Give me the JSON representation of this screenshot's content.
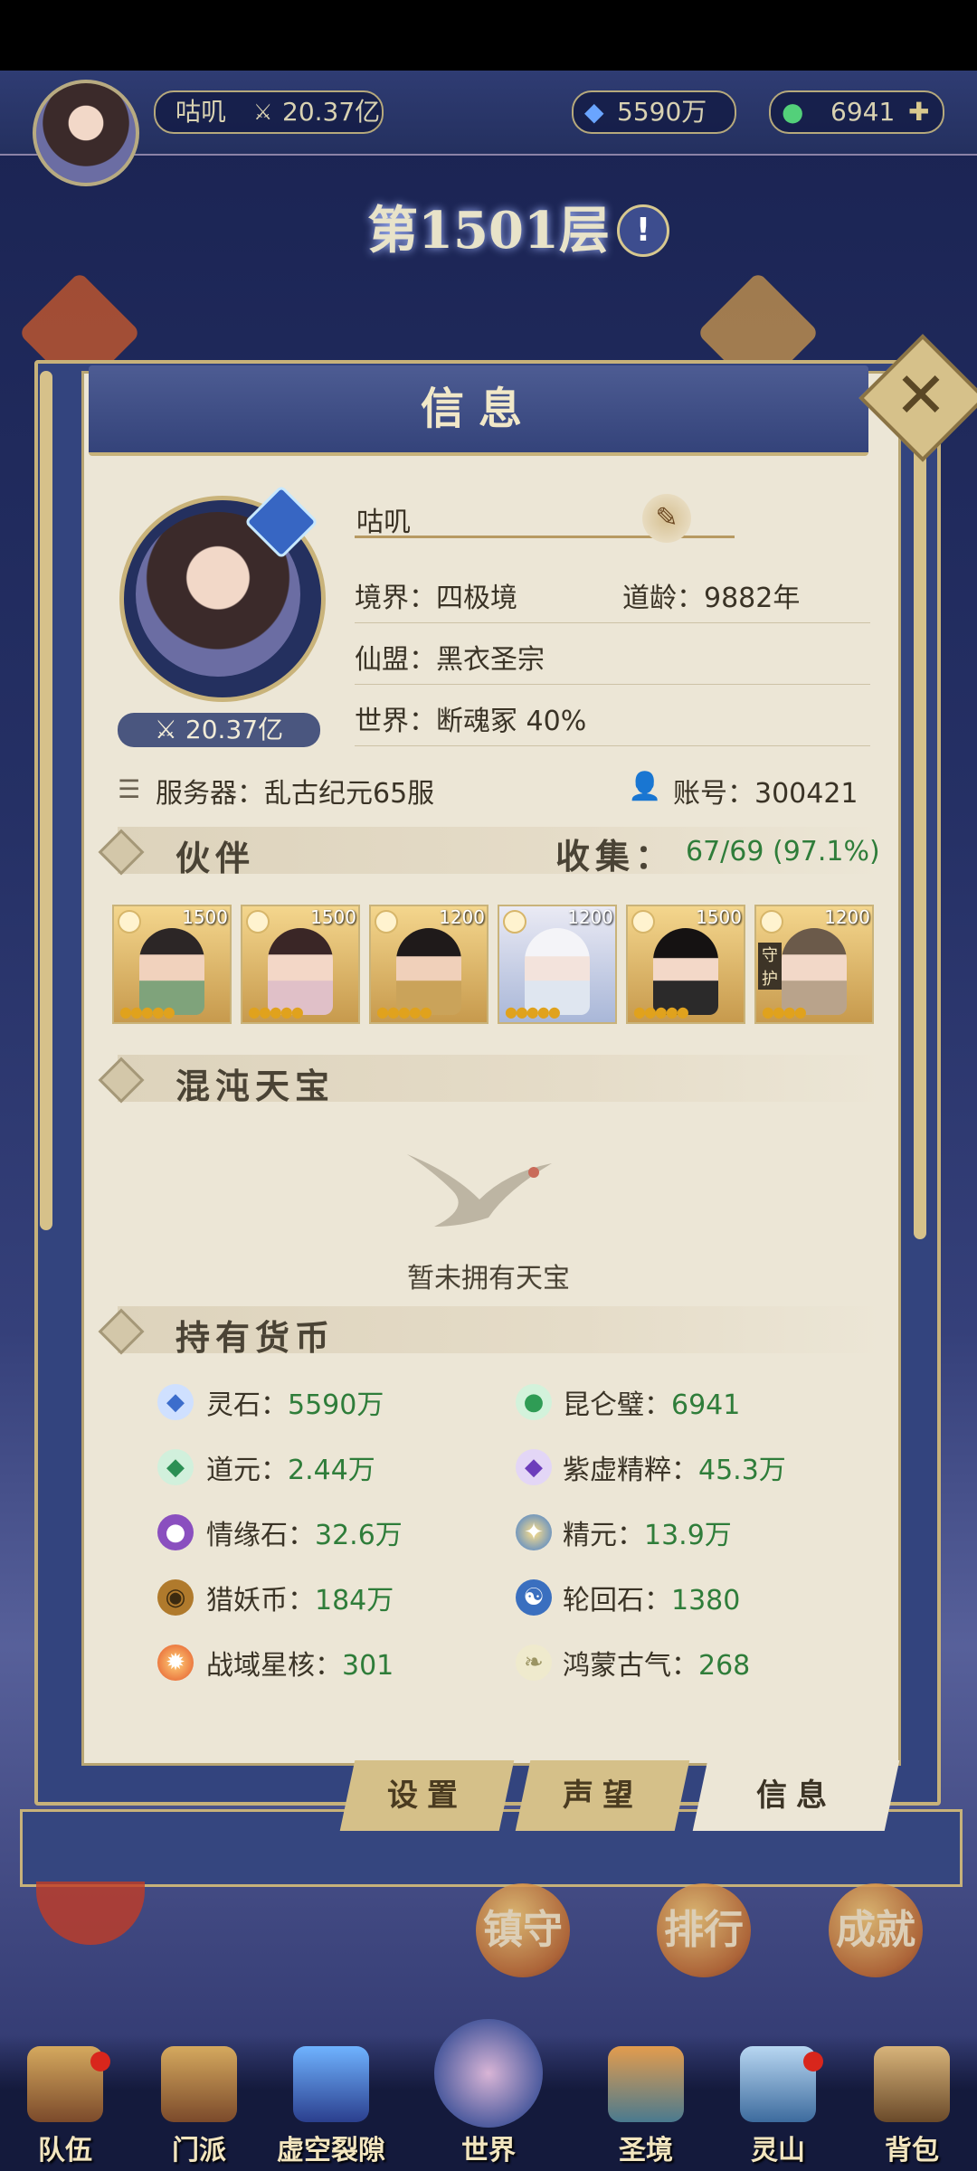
{
  "top_bar": {
    "player_name": "咕叽",
    "power": "20.37亿",
    "spirit_stones": "5590万",
    "jade": "6941"
  },
  "floor": {
    "title": "第1501层",
    "info_icon": "!"
  },
  "panel": {
    "title": "信息",
    "profile": {
      "name": "咕叽",
      "power": "20.37亿",
      "realm": "境界：四极境",
      "dao_age": "道龄：9882年",
      "alliance": "仙盟：黑衣圣宗",
      "world": "世界：断魂冢  40%",
      "server": "服务器：乱古纪元65服",
      "account": "账号：300421"
    },
    "companions": {
      "title": "伙伴",
      "collect_label": "收集：",
      "collect_value": "67/69 (97.1%)",
      "cards": [
        {
          "level": "1500"
        },
        {
          "level": "1500"
        },
        {
          "level": "1200"
        },
        {
          "level": "1200"
        },
        {
          "level": "1500"
        },
        {
          "level": "1200",
          "tag": "守护"
        }
      ]
    },
    "treasure": {
      "title": "混沌天宝",
      "empty_text": "暂未拥有天宝"
    },
    "currency": {
      "title": "持有货币",
      "items": [
        {
          "label": "灵石：",
          "value": "5590万",
          "icon": "spirit-stone-icon",
          "color": "#4a7fd1"
        },
        {
          "label": "昆仑璧：",
          "value": "6941",
          "icon": "jade-disc-icon",
          "color": "#4fbf6b"
        },
        {
          "label": "道元：",
          "value": "2.44万",
          "icon": "dao-crystal-icon",
          "color": "#3aa86a"
        },
        {
          "label": "紫虚精粹：",
          "value": "45.3万",
          "icon": "purple-crystal-icon",
          "color": "#7b4fc6"
        },
        {
          "label": "情缘石：",
          "value": "32.6万",
          "icon": "fate-stone-icon",
          "color": "#8a4fbf"
        },
        {
          "label": "精元：",
          "value": "13.9万",
          "icon": "essence-orb-icon",
          "color": "#e0a12a"
        },
        {
          "label": "猎妖币：",
          "value": "184万",
          "icon": "demon-coin-icon",
          "color": "#b07a2c"
        },
        {
          "label": "轮回石：",
          "value": "1380",
          "icon": "yin-yang-icon",
          "color": "#3a6fbf"
        },
        {
          "label": "战域星核：",
          "value": "301",
          "icon": "star-core-icon",
          "color": "#e4562a"
        },
        {
          "label": "鸿蒙古气：",
          "value": "268",
          "icon": "ancient-qi-icon",
          "color": "#c9c38e"
        }
      ]
    },
    "tabs": {
      "settings": "设置",
      "reputation": "声望",
      "info": "信息"
    }
  },
  "background_buttons": {
    "guard": "镇守",
    "rank": "排行",
    "achievement": "成就"
  },
  "bottom_nav": [
    {
      "label": "队伍"
    },
    {
      "label": "门派"
    },
    {
      "label": "虚空裂隙"
    },
    {
      "label": "世界"
    },
    {
      "label": "圣境"
    },
    {
      "label": "灵山"
    },
    {
      "label": "背包"
    }
  ]
}
